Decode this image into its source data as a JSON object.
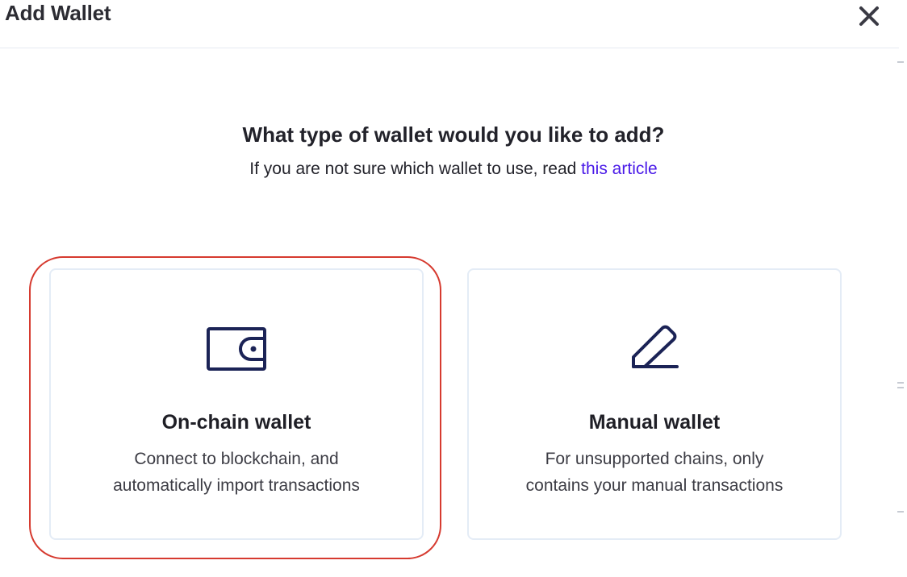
{
  "dialog": {
    "title": "Add Wallet",
    "close_icon": "close-icon"
  },
  "prompt": {
    "question": "What type of wallet would you like to add?",
    "subtitle_prefix": "If you are not sure which wallet to use, read ",
    "link_text": "this article"
  },
  "cards": [
    {
      "icon": "wallet-icon",
      "title": "On-chain wallet",
      "desc_line1": "Connect to blockchain, and",
      "desc_line2": "automatically import transactions"
    },
    {
      "icon": "pencil-icon",
      "title": "Manual wallet",
      "desc_line1": "For unsupported chains, only",
      "desc_line2": "contains your manual transactions"
    }
  ],
  "colors": {
    "icon": "#1b2356",
    "link": "#4a1ae8",
    "highlight": "#d63a2f",
    "card_border": "#e4ecf6"
  }
}
